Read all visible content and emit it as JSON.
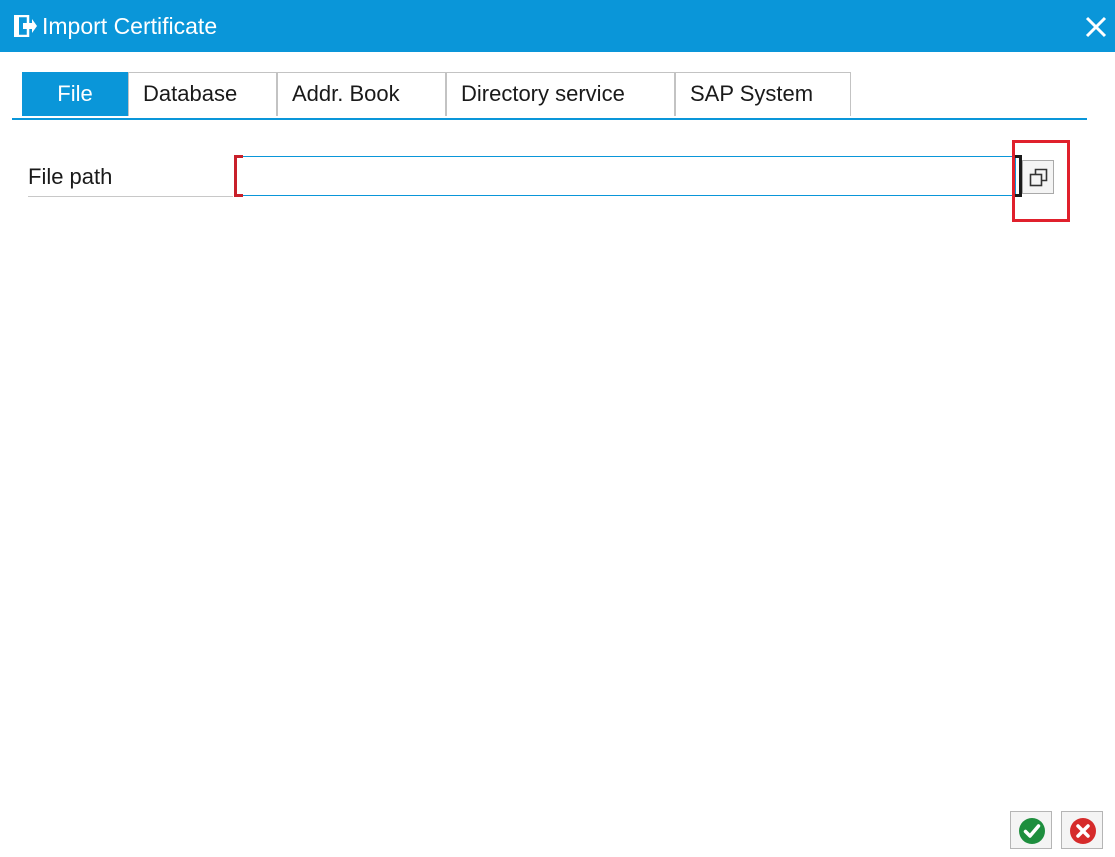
{
  "window": {
    "title": "Import Certificate",
    "icon": "import-window-icon",
    "close_icon": "close-icon"
  },
  "tabs": [
    {
      "label": "File",
      "active": true
    },
    {
      "label": "Database",
      "active": false
    },
    {
      "label": "Addr. Book",
      "active": false
    },
    {
      "label": "Directory service",
      "active": false
    },
    {
      "label": "SAP System",
      "active": false
    }
  ],
  "form": {
    "file_path_label": "File path",
    "file_path_value": "",
    "browse_icon": "browse-file-icon"
  },
  "footer": {
    "ok_icon": "checkmark-icon",
    "cancel_icon": "cancel-icon"
  },
  "colors": {
    "accent": "#0a96d9",
    "highlight": "#e0202c",
    "ok_green": "#1e8e3e",
    "cancel_red": "#d62b2b"
  }
}
